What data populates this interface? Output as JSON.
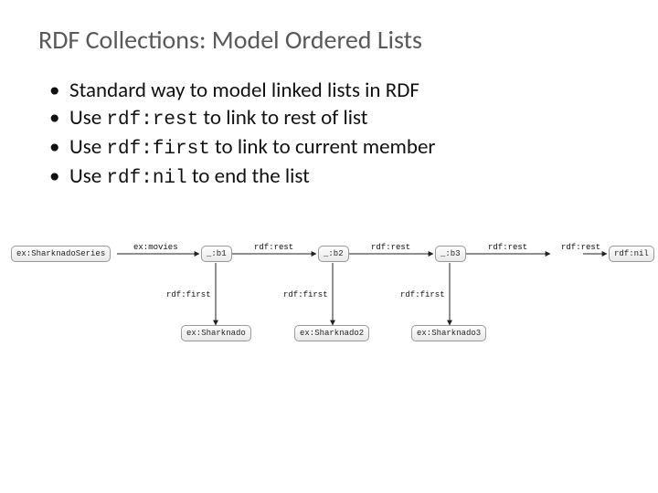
{
  "title": "RDF Collections: Model Ordered Lists",
  "bullets": [
    {
      "pre": "Standard way to model linked lists in RDF",
      "code": "",
      "post": ""
    },
    {
      "pre": "Use ",
      "code": "rdf:rest",
      "post": " to link to rest of list"
    },
    {
      "pre": "Use ",
      "code": "rdf:first",
      "post": " to link to current member"
    },
    {
      "pre": "Use ",
      "code": "rdf:nil",
      "post": " to end the list"
    }
  ],
  "diagram": {
    "nodes": {
      "series": "ex:SharknadoSeries",
      "b1": "_:b1",
      "b2": "_:b2",
      "b3": "_:b3",
      "nil": "rdf:nil",
      "s1": "ex:Sharknado",
      "s2": "ex:Sharknado2",
      "s3": "ex:Sharknado3"
    },
    "edges": {
      "movies": "ex:movies",
      "rest": "rdf:rest",
      "first": "rdf:first"
    }
  }
}
